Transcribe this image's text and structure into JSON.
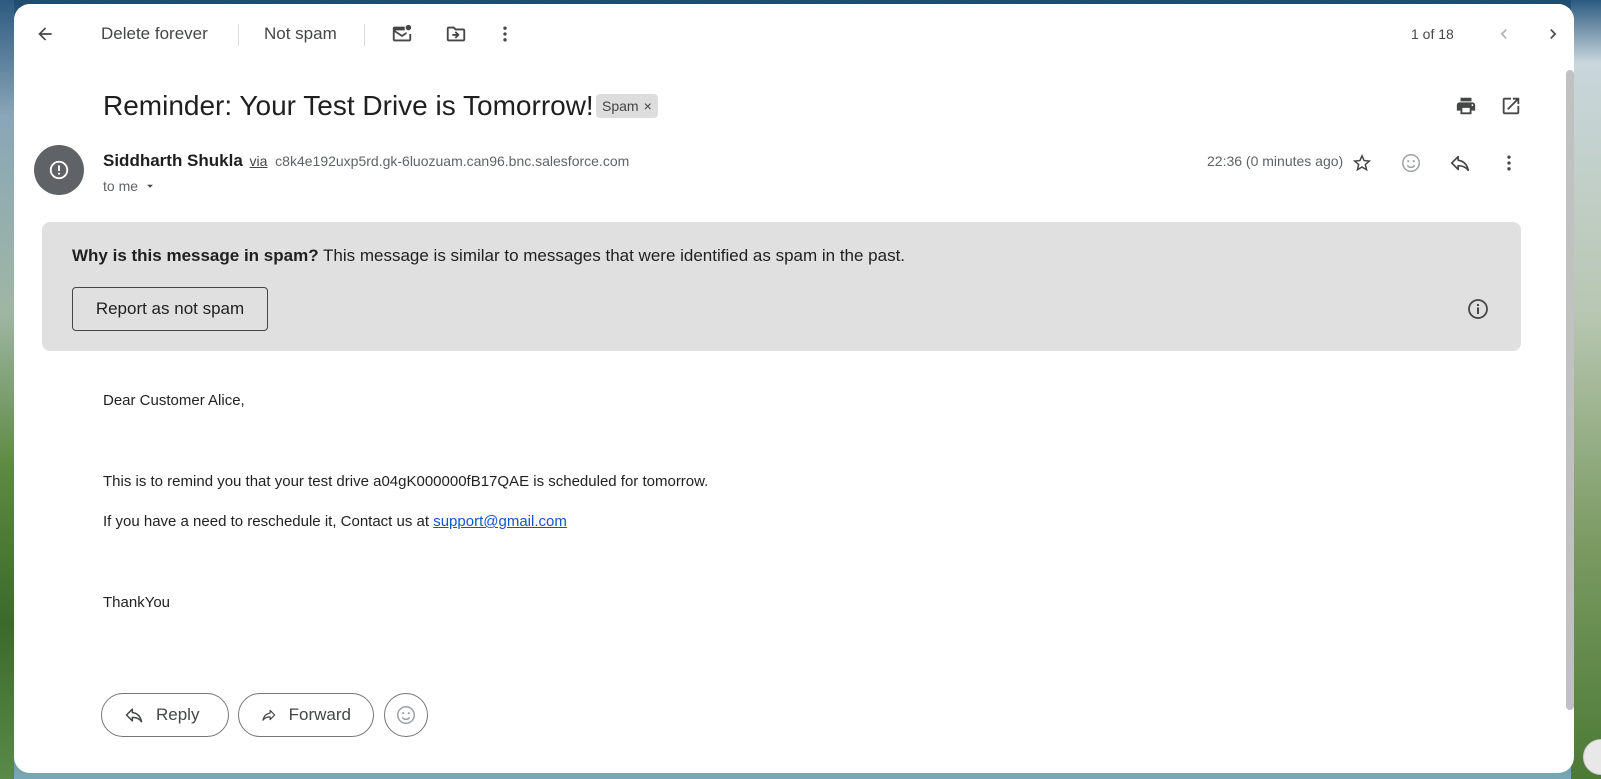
{
  "toolbar": {
    "delete_label": "Delete forever",
    "not_spam_label": "Not spam",
    "counter": "1 of 18"
  },
  "email": {
    "subject": "Reminder: Your Test Drive is Tomorrow!",
    "label_badge": "Spam",
    "sender_name": "Siddharth Shukla",
    "via_text": "via",
    "sender_domain": "c8k4e192uxp5rd.gk-6luozuam.can96.bnc.salesforce.com",
    "recipient": "to me",
    "time": "22:36 (0 minutes ago)"
  },
  "spam_notice": {
    "question": "Why is this message in spam?",
    "explanation": " This message is similar to messages that were identified as spam in the past.",
    "report_button": "Report as not spam"
  },
  "body": {
    "greeting": "Dear Customer Alice,",
    "line1": "This is to remind you that your test drive a04gK000000fB17QAE is scheduled for tomorrow.",
    "line2_prefix": "If you have a need to reschedule it, Contact us at ",
    "support_email": "support@gmail.com",
    "signoff": "ThankYou"
  },
  "actions": {
    "reply_label": "Reply",
    "forward_label": "Forward"
  },
  "colors": {
    "link": "#1155cc",
    "spam_box_bg": "#e0e0e0",
    "avatar_bg": "#5f6368"
  },
  "icons": {
    "back": "arrow-left-icon",
    "mark_unread": "mail-dot-icon",
    "move_to": "folder-move-icon",
    "more": "more-vertical-icon",
    "prev": "chevron-left-icon",
    "next": "chevron-right-icon",
    "print": "print-icon",
    "open_new": "open-in-new-icon",
    "star": "star-icon",
    "emoji": "emoji-icon",
    "reply": "reply-icon",
    "info": "info-icon",
    "warning": "alert-icon"
  }
}
